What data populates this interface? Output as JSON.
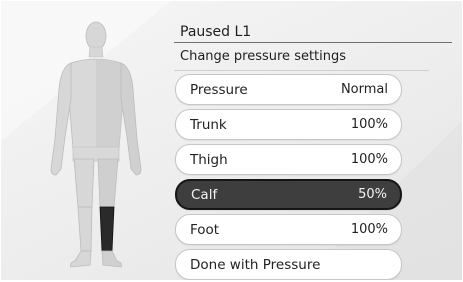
{
  "header": {
    "title": "Paused L1",
    "subtitle": "Change pressure settings"
  },
  "settings": [
    {
      "label": "Pressure",
      "value": "Normal"
    },
    {
      "label": "Trunk",
      "value": "100%"
    },
    {
      "label": "Thigh",
      "value": "100%"
    },
    {
      "label": "Calf",
      "value": "50%",
      "selected": true
    },
    {
      "label": "Foot",
      "value": "100%"
    }
  ],
  "done_label": "Done with Pressure",
  "colors": {
    "body": "#d6d6d6",
    "highlight_zone": "#b9b9b9",
    "selected_segment": "#2a2a2a",
    "selected_row": "#3e3e3e"
  }
}
